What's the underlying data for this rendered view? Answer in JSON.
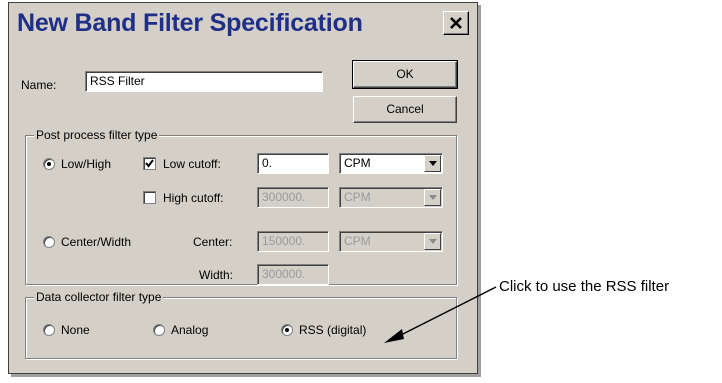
{
  "dialog": {
    "title": "New Band Filter Specification",
    "close_glyph": "✕",
    "name_label": "Name:",
    "name_value": "RSS Filter",
    "ok_label": "OK",
    "cancel_label": "Cancel"
  },
  "post_process": {
    "legend": "Post process filter type",
    "low_high_label": "Low/High",
    "low_cutoff_label": "Low cutoff:",
    "low_cutoff_value": "0.",
    "low_cutoff_unit": "CPM",
    "high_cutoff_label": "High cutoff:",
    "high_cutoff_value": "300000.",
    "high_cutoff_unit": "CPM",
    "center_width_label": "Center/Width",
    "center_label": "Center:",
    "center_value": "150000.",
    "center_unit": "CPM",
    "width_label": "Width:",
    "width_value": "300000."
  },
  "data_collector": {
    "legend": "Data collector filter type",
    "none_label": "None",
    "analog_label": "Analog",
    "rss_label": "RSS (digital)"
  },
  "annotation": {
    "text": "Click to use the RSS filter"
  },
  "colors": {
    "title_text": "#1f2f88",
    "dialog_face": "#d4d0c8"
  }
}
